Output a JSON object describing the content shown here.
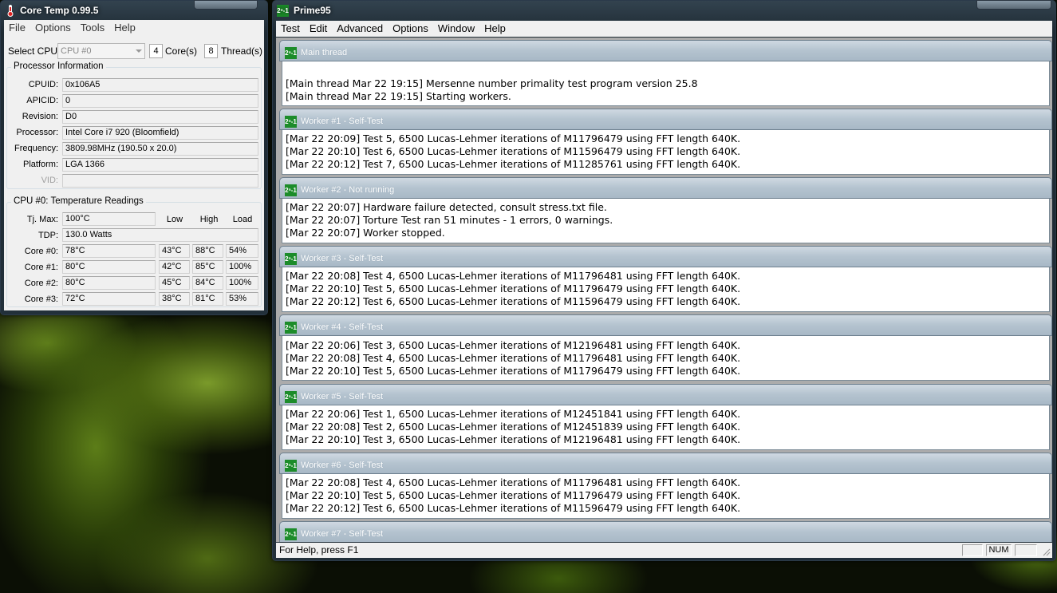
{
  "coretemp": {
    "title": "Core Temp 0.99.5",
    "menu": [
      "File",
      "Options",
      "Tools",
      "Help"
    ],
    "select_cpu_label": "Select CPU:",
    "selected_cpu": "CPU #0",
    "cores_value": "4",
    "cores_label": "Core(s)",
    "threads_value": "8",
    "threads_label": "Thread(s)",
    "processor_info_title": "Processor Information",
    "info": [
      {
        "label": "CPUID:",
        "value": "0x106A5"
      },
      {
        "label": "APICID:",
        "value": "0"
      },
      {
        "label": "Revision:",
        "value": "D0"
      },
      {
        "label": "Processor:",
        "value": "Intel Core i7 920 (Bloomfield)"
      },
      {
        "label": "Frequency:",
        "value": "3809.98MHz (190.50 x 20.0)"
      },
      {
        "label": "Platform:",
        "value": "LGA 1366"
      },
      {
        "label": "VID:",
        "value": ""
      }
    ],
    "temps_title": "CPU #0: Temperature Readings",
    "tjmax_label": "Tj. Max:",
    "tjmax_value": "100°C",
    "tdp_label": "TDP:",
    "tdp_value": "130.0 Watts",
    "col_low": "Low",
    "col_high": "High",
    "col_load": "Load",
    "cores": [
      {
        "label": "Core #0:",
        "temp": "78°C",
        "low": "43°C",
        "high": "88°C",
        "load": "54%"
      },
      {
        "label": "Core #1:",
        "temp": "80°C",
        "low": "42°C",
        "high": "85°C",
        "load": "100%"
      },
      {
        "label": "Core #2:",
        "temp": "80°C",
        "low": "45°C",
        "high": "84°C",
        "load": "100%"
      },
      {
        "label": "Core #3:",
        "temp": "72°C",
        "low": "38°C",
        "high": "81°C",
        "load": "53%"
      }
    ]
  },
  "prime": {
    "title": "Prime95",
    "menu": [
      "Test",
      "Edit",
      "Advanced",
      "Options",
      "Window",
      "Help"
    ],
    "icon_text": "2ⁿ-1",
    "windows": [
      {
        "title": "Main thread",
        "lines": [
          "[Main thread Mar 22 19:15] Mersenne number primality test program version 25.8",
          "[Main thread Mar 22 19:15] Starting workers."
        ]
      },
      {
        "title": "Worker #1 - Self-Test",
        "lines": [
          "[Mar 22 20:09] Test 5, 6500 Lucas-Lehmer iterations of M11796479 using FFT length 640K.",
          "[Mar 22 20:10] Test 6, 6500 Lucas-Lehmer iterations of M11596479 using FFT length 640K.",
          "[Mar 22 20:12] Test 7, 6500 Lucas-Lehmer iterations of M11285761 using FFT length 640K."
        ]
      },
      {
        "title": "Worker #2 - Not running",
        "lines": [
          "[Mar 22 20:07] Hardware failure detected, consult stress.txt file.",
          "[Mar 22 20:07] Torture Test ran 51 minutes - 1 errors, 0 warnings.",
          "[Mar 22 20:07] Worker stopped."
        ]
      },
      {
        "title": "Worker #3 - Self-Test",
        "lines": [
          "[Mar 22 20:08] Test 4, 6500 Lucas-Lehmer iterations of M11796481 using FFT length 640K.",
          "[Mar 22 20:10] Test 5, 6500 Lucas-Lehmer iterations of M11796479 using FFT length 640K.",
          "[Mar 22 20:12] Test 6, 6500 Lucas-Lehmer iterations of M11596479 using FFT length 640K."
        ]
      },
      {
        "title": "Worker #4 - Self-Test",
        "lines": [
          "[Mar 22 20:06] Test 3, 6500 Lucas-Lehmer iterations of M12196481 using FFT length 640K.",
          "[Mar 22 20:08] Test 4, 6500 Lucas-Lehmer iterations of M11796481 using FFT length 640K.",
          "[Mar 22 20:10] Test 5, 6500 Lucas-Lehmer iterations of M11796479 using FFT length 640K."
        ]
      },
      {
        "title": "Worker #5 - Self-Test",
        "lines": [
          "[Mar 22 20:06] Test 1, 6500 Lucas-Lehmer iterations of M12451841 using FFT length 640K.",
          "[Mar 22 20:08] Test 2, 6500 Lucas-Lehmer iterations of M12451839 using FFT length 640K.",
          "[Mar 22 20:10] Test 3, 6500 Lucas-Lehmer iterations of M12196481 using FFT length 640K."
        ]
      },
      {
        "title": "Worker #6 - Self-Test",
        "lines": [
          "[Mar 22 20:08] Test 4, 6500 Lucas-Lehmer iterations of M11796481 using FFT length 640K.",
          "[Mar 22 20:10] Test 5, 6500 Lucas-Lehmer iterations of M11796479 using FFT length 640K.",
          "[Mar 22 20:12] Test 6, 6500 Lucas-Lehmer iterations of M11596479 using FFT length 640K."
        ]
      },
      {
        "title": "Worker #7 - Self-Test",
        "lines": []
      }
    ],
    "status_text": "For Help, press F1",
    "status_num": "NUM"
  }
}
